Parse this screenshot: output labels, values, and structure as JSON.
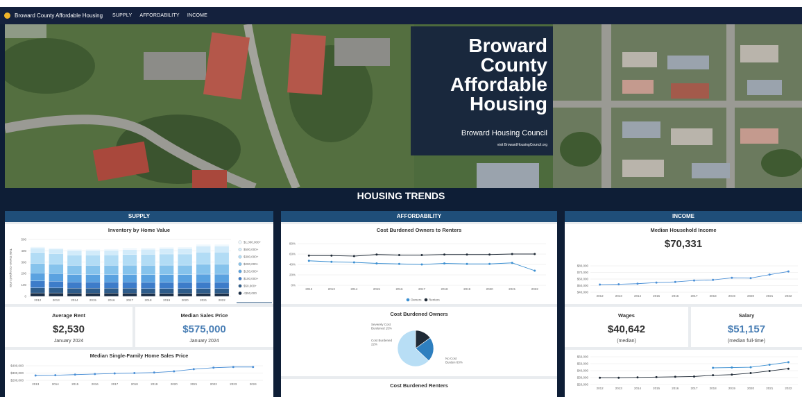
{
  "nav": {
    "title": "Broward County Affordable Housing",
    "links": [
      "SUPPLY",
      "AFFORDABILITY",
      "INCOME"
    ]
  },
  "hero": {
    "title_lines": [
      "Broward",
      "County",
      "Affordable",
      "Housing"
    ],
    "org": "Broward Housing Council",
    "visit": "visit BrowardHousingCouncil.org"
  },
  "section_title": "HOUSING TRENDS",
  "supply": {
    "header": "SUPPLY",
    "inventory_title": "Inventory by Home Value",
    "rent_label": "Average Rent",
    "rent_value": "$2,530",
    "rent_date": "January 2024",
    "sales_label": "Median Sales Price",
    "sales_value": "$575,000",
    "sales_date": "January 2024",
    "sf_title": "Median Single-Family Home Sales Price"
  },
  "affordability": {
    "header": "AFFORDABILITY",
    "cb_title": "Cost Burdened Owners to Renters",
    "owners_title": "Cost Burdened Owners",
    "renters_title": "Cost Burdened Renters"
  },
  "income": {
    "header": "INCOME",
    "mhi_label": "Median Household Income",
    "mhi_value": "$70,331",
    "wages_label": "Wages",
    "wages_value": "$40,642",
    "wages_note": "(median)",
    "salary_label": "Salary",
    "salary_value": "$51,157",
    "salary_note": "(median full-time)"
  },
  "colors": {
    "navy": "#14213d",
    "section_blue": "#1f4e79",
    "accent_blue": "#4a7fb5"
  },
  "chart_data": [
    {
      "id": "inventory",
      "type": "bar",
      "stacked": true,
      "title": "Inventory by Home Value",
      "ylabel": "Total Owner-Occupied Units",
      "categories": [
        "2012",
        "2013",
        "2014",
        "2015",
        "2016",
        "2017",
        "2018",
        "2019",
        "2020",
        "2021",
        "2022"
      ],
      "ylim": [
        0,
        500
      ],
      "yticks": [
        "0",
        "100",
        "200",
        "300",
        "400",
        "500"
      ],
      "series": [
        {
          "name": "<$50,000",
          "color": "#1a2e47",
          "values": [
            30,
            30,
            28,
            28,
            28,
            28,
            26,
            26,
            26,
            26,
            26
          ]
        },
        {
          "name": "$50,000+",
          "color": "#2e5c8a",
          "values": [
            45,
            44,
            43,
            43,
            43,
            43,
            42,
            42,
            42,
            42,
            42
          ]
        },
        {
          "name": "$100,000+",
          "color": "#3d7cc9",
          "values": [
            60,
            58,
            55,
            55,
            55,
            55,
            55,
            55,
            55,
            57,
            57
          ]
        },
        {
          "name": "$150,000+",
          "color": "#5aa2e0",
          "values": [
            70,
            68,
            66,
            66,
            66,
            66,
            67,
            67,
            67,
            70,
            70
          ]
        },
        {
          "name": "$200,000+",
          "color": "#86c3ec",
          "values": [
            85,
            82,
            80,
            80,
            81,
            82,
            83,
            84,
            84,
            88,
            88
          ]
        },
        {
          "name": "$300,000+",
          "color": "#b2dcf5",
          "values": [
            95,
            93,
            91,
            91,
            92,
            94,
            96,
            98,
            98,
            105,
            105
          ]
        },
        {
          "name": "$500,000+",
          "color": "#d2ebfa",
          "values": [
            40,
            40,
            40,
            40,
            40,
            43,
            45,
            47,
            48,
            53,
            53
          ]
        },
        {
          "name": "$1,000,000+",
          "color": "#eef7fd",
          "values": [
            10,
            10,
            10,
            10,
            10,
            12,
            12,
            13,
            13,
            15,
            15
          ]
        }
      ]
    },
    {
      "id": "sf_sales",
      "type": "line",
      "title": "Median Single-Family Home Sales Price",
      "x": [
        "2013",
        "2014",
        "2015",
        "2016",
        "2017",
        "2018",
        "2019",
        "2020",
        "2021",
        "2022",
        "2023",
        "2024"
      ],
      "yticks": [
        "$400,000",
        "$300,000",
        "$200,000"
      ],
      "ylim": [
        150000,
        450000
      ],
      "series": [
        {
          "name": "Median Sales Price",
          "values": [
            250000,
            255000,
            268000,
            280000,
            292000,
            300000,
            310000,
            335000,
            380000,
            410000,
            425000,
            425000
          ]
        }
      ]
    },
    {
      "id": "cb_owners_renters",
      "type": "line",
      "title": "Cost Burdened Owners to Renters",
      "x": [
        "2012",
        "2013",
        "2014",
        "2015",
        "2016",
        "2017",
        "2018",
        "2019",
        "2020",
        "2021",
        "2022"
      ],
      "yticks": [
        "80%",
        "60%",
        "40%",
        "20%",
        "0%"
      ],
      "ylim": [
        0,
        80
      ],
      "series": [
        {
          "name": "Owners",
          "color": "#3b8fd1",
          "values": [
            47,
            45,
            44,
            42,
            41,
            40,
            42,
            41,
            41,
            43,
            28
          ]
        },
        {
          "name": "Renters",
          "color": "#1f2a36",
          "values": [
            57,
            57,
            56,
            59,
            58,
            58,
            59,
            59,
            59,
            60,
            60
          ]
        }
      ],
      "legend": "bottom"
    },
    {
      "id": "cb_owners",
      "type": "pie",
      "title": "Cost Burdened Owners",
      "slices": [
        {
          "label": "Severely Cost Burdened 15%",
          "value": 15,
          "color": "#1f2a36"
        },
        {
          "label": "Cost Burdened 22%",
          "value": 22,
          "color": "#2e7fbf"
        },
        {
          "label": "No Cost Burden 63%",
          "value": 63,
          "color": "#b8def5"
        }
      ]
    },
    {
      "id": "mhi",
      "type": "line",
      "title": "Median Household Income",
      "x": [
        "2012",
        "2013",
        "2014",
        "2015",
        "2016",
        "2017",
        "2018",
        "2019",
        "2020",
        "2021",
        "2022"
      ],
      "yticks": [
        "$80,000",
        "$70,000",
        "$60,000",
        "$50,000",
        "$40,000"
      ],
      "ylim": [
        35000,
        80000
      ],
      "series": [
        {
          "name": "Median Household Income",
          "values": [
            48000,
            48500,
            49500,
            51500,
            52500,
            55000,
            56000,
            59500,
            59000,
            65000,
            70331
          ]
        }
      ]
    },
    {
      "id": "wages_salary",
      "type": "line",
      "x": [
        "2012",
        "2013",
        "2014",
        "2015",
        "2016",
        "2017",
        "2018",
        "2019",
        "2020",
        "2021",
        "2022"
      ],
      "yticks": [
        "$60,000",
        "$50,000",
        "$40,000",
        "$30,000",
        "$20,000"
      ],
      "ylim": [
        15000,
        60000
      ],
      "series": [
        {
          "name": "Wages",
          "color": "#1f2a36",
          "values": [
            26000,
            26000,
            26500,
            27000,
            27500,
            28000,
            30000,
            31000,
            33500,
            37000,
            40642
          ]
        },
        {
          "name": "Salary",
          "color": "#3b8fd1",
          "values": [
            null,
            null,
            null,
            null,
            null,
            null,
            42000,
            42500,
            43000,
            47000,
            51157
          ]
        }
      ]
    }
  ]
}
